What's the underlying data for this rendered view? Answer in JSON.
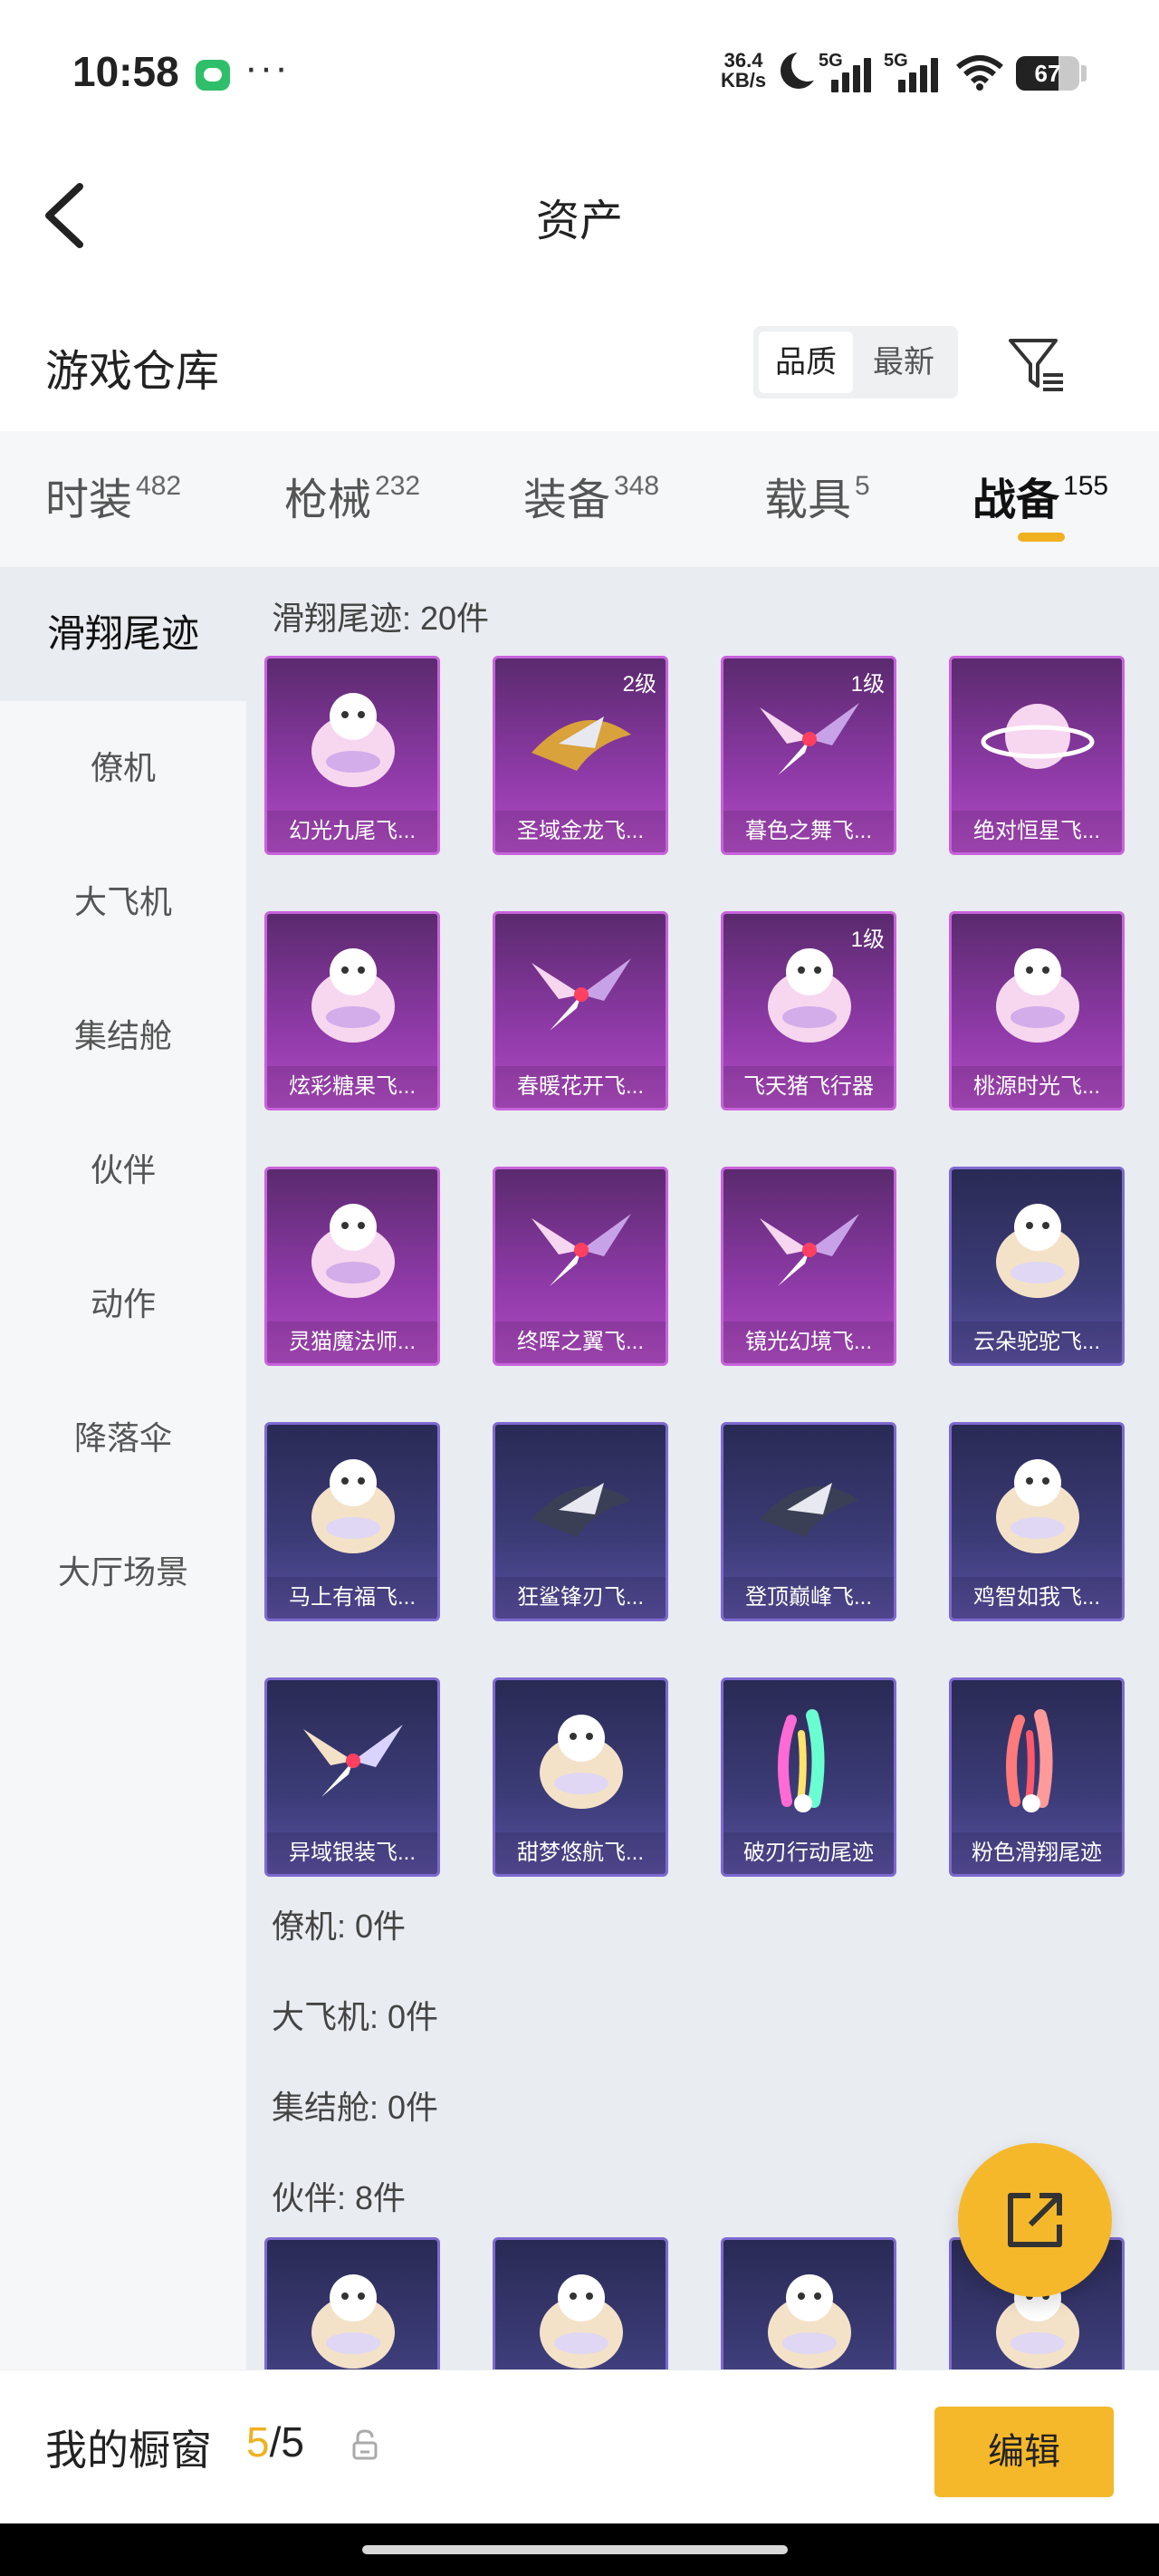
{
  "status_bar": {
    "time": "10:58",
    "net_speed_value": "36.4",
    "net_speed_unit": "KB/s",
    "signal_label": "5G",
    "battery": "67",
    "battery_level": 0.67
  },
  "header": {
    "title": "资产"
  },
  "warehouse": {
    "title": "游戏仓库",
    "sort_options": [
      "品质",
      "最新"
    ],
    "sort_selected": "品质"
  },
  "tabs": [
    {
      "label": "时装",
      "count": "482"
    },
    {
      "label": "枪械",
      "count": "232"
    },
    {
      "label": "装备",
      "count": "348"
    },
    {
      "label": "载具",
      "count": "5"
    },
    {
      "label": "战备",
      "count": "155",
      "active": true
    }
  ],
  "sidebar": [
    {
      "label": "滑翔尾迹",
      "active": true
    },
    {
      "label": "僚机"
    },
    {
      "label": "大飞机"
    },
    {
      "label": "集结舱"
    },
    {
      "label": "伙伴"
    },
    {
      "label": "动作"
    },
    {
      "label": "降落伞"
    },
    {
      "label": "大厅场景"
    }
  ],
  "sections": {
    "glide_trail": "滑翔尾迹: 20件",
    "wingman": "僚机: 0件",
    "big_plane": "大飞机: 0件",
    "assembly_pod": "集结舱: 0件",
    "partner": "伙伴: 8件"
  },
  "items": [
    {
      "name": "幻光九尾飞...",
      "level": "",
      "tier": "purple",
      "icon": "fox-tail-icon"
    },
    {
      "name": "圣域金龙飞...",
      "level": "2级",
      "tier": "purple",
      "icon": "golden-dragon-icon"
    },
    {
      "name": "暮色之舞飞...",
      "level": "1级",
      "tier": "purple",
      "icon": "dusk-wings-icon"
    },
    {
      "name": "绝对恒星飞...",
      "level": "",
      "tier": "purple",
      "icon": "planet-icon"
    },
    {
      "name": "炫彩糖果飞...",
      "level": "",
      "tier": "purple",
      "icon": "candy-icon"
    },
    {
      "name": "春暖花开飞...",
      "level": "",
      "tier": "purple",
      "icon": "butterfly-icon"
    },
    {
      "name": "飞天猪飞行器",
      "level": "1级",
      "tier": "purple",
      "icon": "pig-icon"
    },
    {
      "name": "桃源时光飞...",
      "level": "",
      "tier": "purple",
      "icon": "peach-icon"
    },
    {
      "name": "灵猫魔法师...",
      "level": "",
      "tier": "purple",
      "icon": "cat-icon"
    },
    {
      "name": "终晖之翼飞...",
      "level": "",
      "tier": "purple",
      "icon": "star-wings-icon"
    },
    {
      "name": "镜光幻境飞...",
      "level": "",
      "tier": "purple",
      "icon": "crystal-wings-icon"
    },
    {
      "name": "云朵驼驼飞...",
      "level": "",
      "tier": "blue",
      "icon": "alpaca-icon"
    },
    {
      "name": "马上有福飞...",
      "level": "",
      "tier": "blue",
      "icon": "horse-icon"
    },
    {
      "name": "狂鲨锋刃飞...",
      "level": "",
      "tier": "blue",
      "icon": "shark-icon"
    },
    {
      "name": "登顶巅峰飞...",
      "level": "",
      "tier": "blue",
      "icon": "jet-icon"
    },
    {
      "name": "鸡智如我飞...",
      "level": "",
      "tier": "blue",
      "icon": "chicken-icon"
    },
    {
      "name": "异域银装飞...",
      "level": "",
      "tier": "blue",
      "icon": "silver-wing-icon"
    },
    {
      "name": "甜梦悠航飞...",
      "level": "",
      "tier": "blue",
      "icon": "ufo-icon"
    },
    {
      "name": "破刃行动尾迹",
      "level": "",
      "tier": "blue",
      "icon": "rainbow-smoke-icon"
    },
    {
      "name": "粉色滑翔尾迹",
      "level": "",
      "tier": "blue",
      "icon": "pink-smoke-icon"
    }
  ],
  "partner_items": [
    {
      "icon": "chicken-partner-icon"
    },
    {
      "icon": "cat-partner-icon"
    },
    {
      "icon": "angel-partner-icon"
    },
    {
      "icon": "pig-partner-icon"
    }
  ],
  "bottom_bar": {
    "label": "我的橱窗",
    "current": "5",
    "total": "/5",
    "edit_label": "编辑"
  },
  "colors": {
    "accent": "#f5b82a",
    "purple_tier": "#b14cc4",
    "blue_tier": "#5a4fa0"
  }
}
